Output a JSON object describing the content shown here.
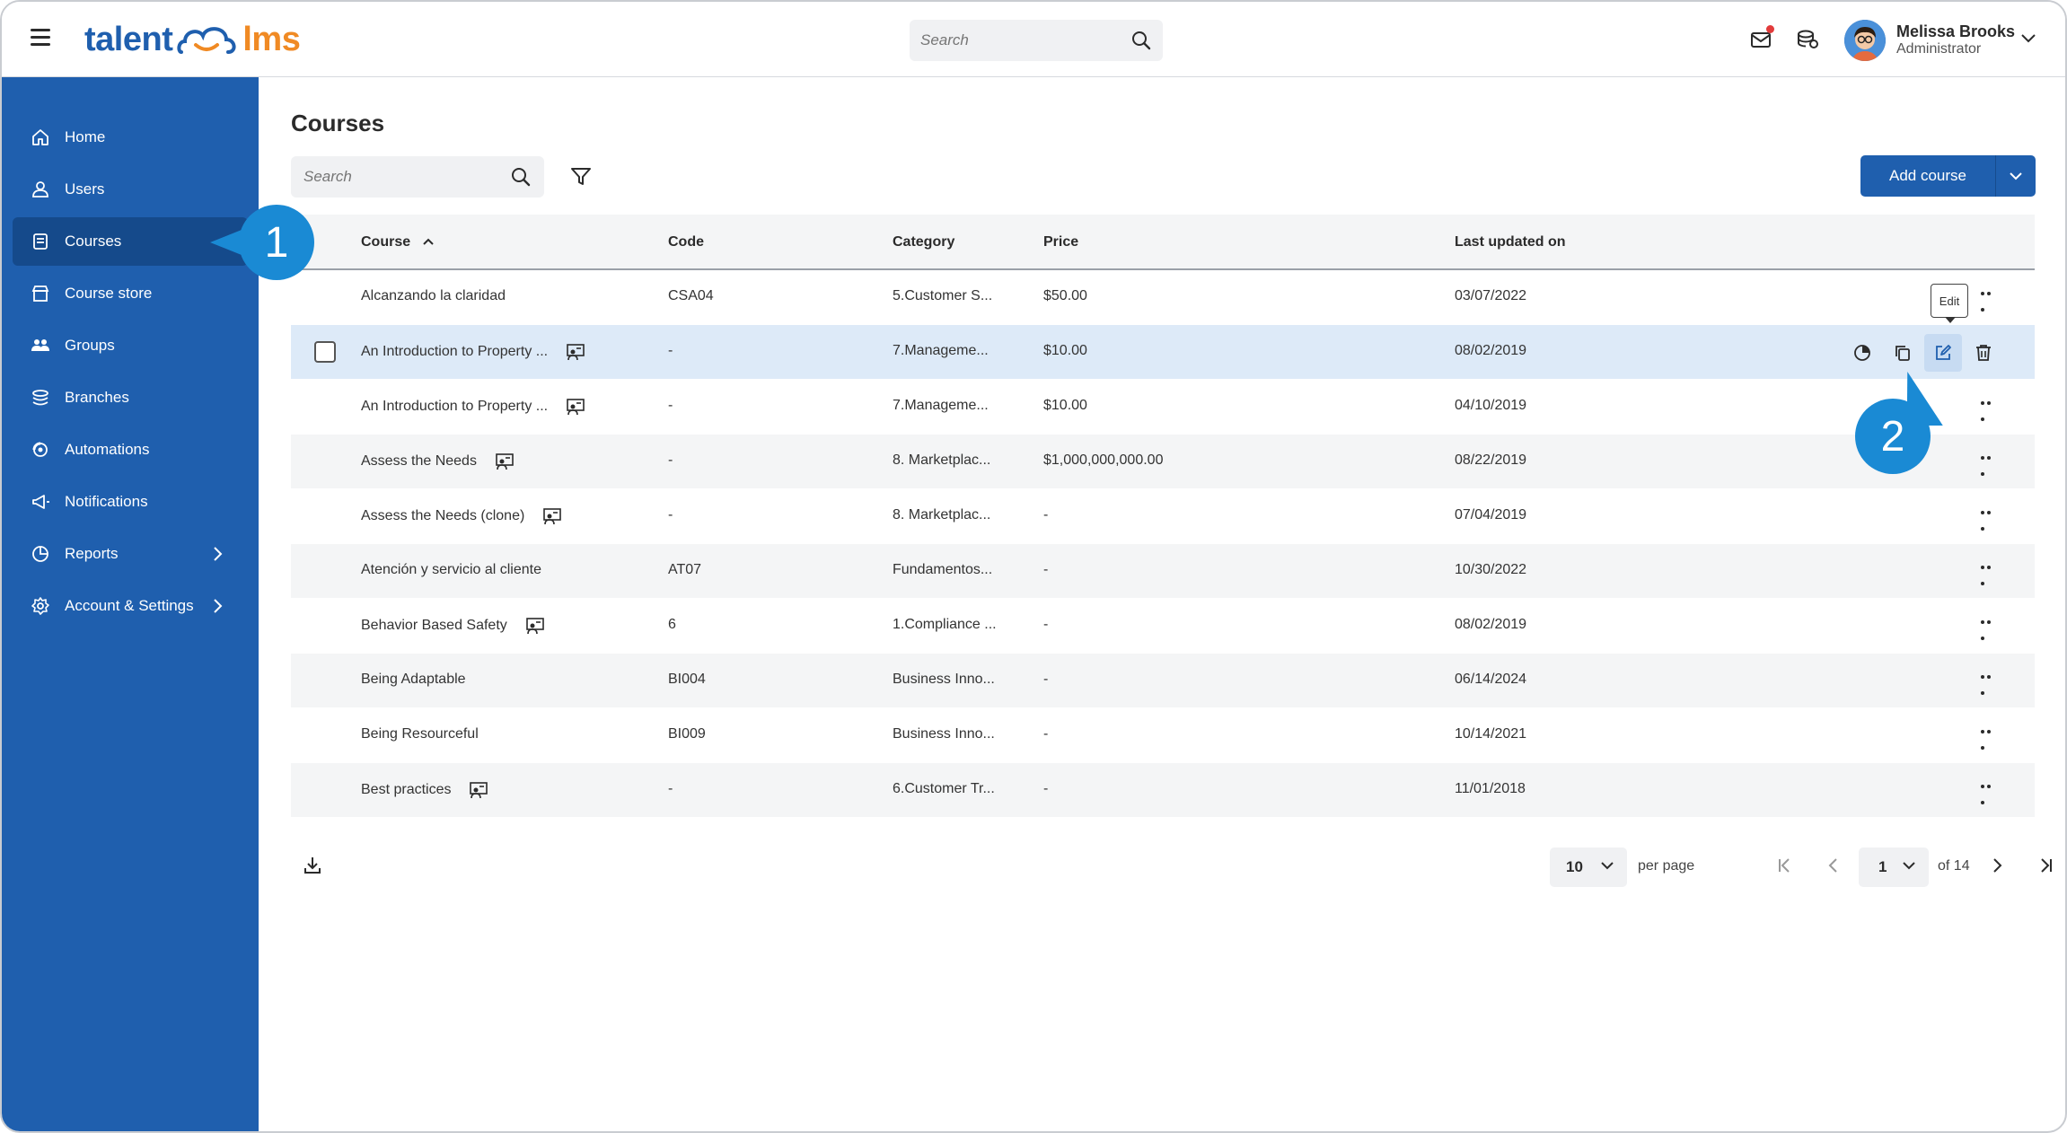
{
  "topbar": {
    "logo_left": "talent",
    "logo_right": "lms",
    "search_placeholder": "Search",
    "user_name": "Melissa Brooks",
    "user_role": "Administrator"
  },
  "sidebar": {
    "items": [
      {
        "label": "Home",
        "icon": "home-icon"
      },
      {
        "label": "Users",
        "icon": "user-icon"
      },
      {
        "label": "Courses",
        "icon": "book-icon",
        "active": true
      },
      {
        "label": "Course store",
        "icon": "store-icon"
      },
      {
        "label": "Groups",
        "icon": "groups-icon"
      },
      {
        "label": "Branches",
        "icon": "layers-icon"
      },
      {
        "label": "Automations",
        "icon": "automation-icon"
      },
      {
        "label": "Notifications",
        "icon": "megaphone-icon"
      },
      {
        "label": "Reports",
        "icon": "pie-chart-icon"
      },
      {
        "label": "Account & Settings",
        "icon": "gear-icon"
      }
    ]
  },
  "main": {
    "title": "Courses",
    "search_placeholder": "Search",
    "add_course_label": "Add course",
    "columns": {
      "course": "Course",
      "code": "Code",
      "category": "Category",
      "price": "Price",
      "updated": "Last updated on"
    },
    "rows": [
      {
        "name": "Alcanzando la claridad",
        "code": "CSA04",
        "category": "5.Customer S...",
        "price": "$50.00",
        "updated": "03/07/2022",
        "ilt": false
      },
      {
        "name": "An Introduction to Property ...",
        "code": "-",
        "category": "7.Manageme...",
        "price": "$10.00",
        "updated": "08/02/2019",
        "ilt": true
      },
      {
        "name": "An Introduction to Property ...",
        "code": "-",
        "category": "7.Manageme...",
        "price": "$10.00",
        "updated": "04/10/2019",
        "ilt": true
      },
      {
        "name": "Assess the Needs",
        "code": "-",
        "category": "8. Marketplac...",
        "price": "$1,000,000,000.00",
        "updated": "08/22/2019",
        "ilt": true
      },
      {
        "name": "Assess the Needs (clone)",
        "code": "-",
        "category": "8. Marketplac...",
        "price": "-",
        "updated": "07/04/2019",
        "ilt": true
      },
      {
        "name": "Atención y servicio al cliente",
        "code": "AT07",
        "category": "Fundamentos...",
        "price": "-",
        "updated": "10/30/2022",
        "ilt": false
      },
      {
        "name": "Behavior Based Safety",
        "code": "6",
        "category": "1.Compliance ...",
        "price": "-",
        "updated": "08/02/2019",
        "ilt": true
      },
      {
        "name": "Being Adaptable",
        "code": "BI004",
        "category": "Business Inno...",
        "price": "-",
        "updated": "06/14/2024",
        "ilt": false
      },
      {
        "name": "Being Resourceful",
        "code": "BI009",
        "category": "Business Inno...",
        "price": "-",
        "updated": "10/14/2021",
        "ilt": false
      },
      {
        "name": "Best practices",
        "code": "-",
        "category": "6.Customer Tr...",
        "price": "-",
        "updated": "11/01/2018",
        "ilt": true
      }
    ],
    "tooltip_edit": "Edit"
  },
  "footer": {
    "per_page_value": "10",
    "per_page_label": "per page",
    "page_value": "1",
    "of_label": "of 14"
  },
  "callouts": {
    "one": "1",
    "two": "2"
  },
  "colors": {
    "brand": "#1f5fae",
    "accent": "#f08a24",
    "callout": "#1a8ad4",
    "highlight": "#ddeaf8"
  }
}
